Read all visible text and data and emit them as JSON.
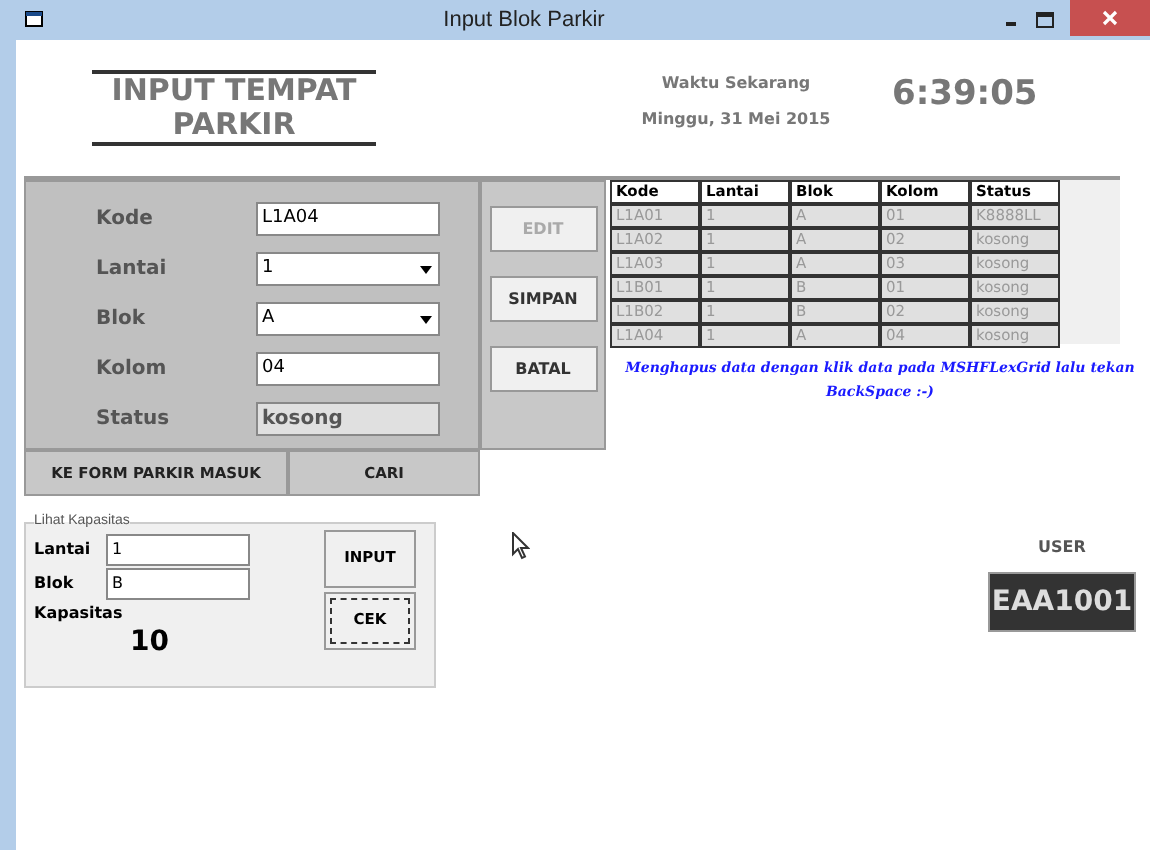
{
  "window": {
    "title": "Input Blok Parkir"
  },
  "header": {
    "title_line1": "INPUT TEMPAT",
    "title_line2": "PARKIR",
    "clock_label": "Waktu Sekarang",
    "date": "Minggu, 31 Mei 2015",
    "time": "6:39:05"
  },
  "form": {
    "fields": [
      {
        "label": "Kode",
        "value": "L1A04",
        "kind": "text",
        "disabled": false
      },
      {
        "label": "Lantai",
        "value": "1",
        "kind": "dropdown"
      },
      {
        "label": "Blok",
        "value": "A",
        "kind": "dropdown"
      },
      {
        "label": "Kolom",
        "value": "04",
        "kind": "text",
        "disabled": false
      },
      {
        "label": "Status",
        "value": "kosong",
        "kind": "text",
        "disabled": true
      }
    ],
    "side_buttons": [
      {
        "label": "EDIT",
        "disabled": true
      },
      {
        "label": "SIMPAN",
        "disabled": false
      },
      {
        "label": "BATAL",
        "disabled": false
      }
    ],
    "bottom_buttons": [
      "KE FORM PARKIR MASUK",
      "CARI"
    ]
  },
  "table": {
    "columns": [
      "Kode",
      "Lantai",
      "Blok",
      "Kolom",
      "Status"
    ],
    "rows": [
      [
        "L1A01",
        "1",
        "A",
        "01",
        "K8888LL"
      ],
      [
        "L1A02",
        "1",
        "A",
        "02",
        "kosong"
      ],
      [
        "L1A03",
        "1",
        "A",
        "03",
        "kosong"
      ],
      [
        "L1B01",
        "1",
        "B",
        "01",
        "kosong"
      ],
      [
        "L1B02",
        "1",
        "B",
        "02",
        "kosong"
      ],
      [
        "L1A04",
        "1",
        "A",
        "04",
        "kosong"
      ]
    ]
  },
  "note": "Menghapus data dengan klik data pada MSHFLexGrid lalu tekan BackSpace :-)",
  "capacity": {
    "legend": "Lihat Kapasitas",
    "fields": [
      {
        "label": "Lantai",
        "value": "1"
      },
      {
        "label": "Blok",
        "value": "B"
      }
    ],
    "result_label": "Kapasitas",
    "result": "10",
    "buttons": [
      {
        "label": "INPUT",
        "focused": false
      },
      {
        "label": "CEK",
        "focused": true
      }
    ]
  },
  "user": {
    "label": "USER",
    "value": "EAA1001"
  }
}
